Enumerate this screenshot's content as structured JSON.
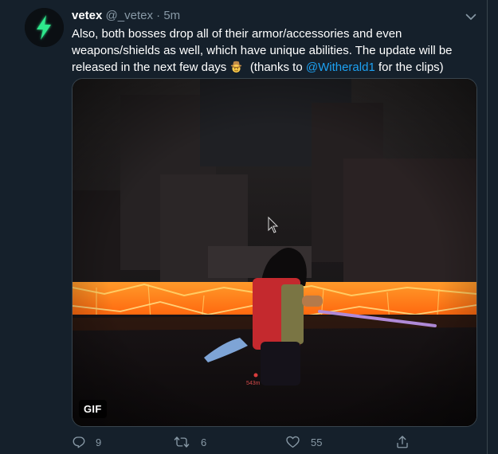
{
  "tweet": {
    "name": "vetex",
    "handle": "@_vetex",
    "separator": "·",
    "time": "5m",
    "text_line1": "Also, both bosses drop all of their armor/accessories and even",
    "text_line2": "weapons/shields as well, which have unique abilities. The update will be",
    "text_line3_before": "released in the next few days",
    "text_line3_paren_open": "(thanks to",
    "mention": "@Witherald1",
    "text_line3_after": "for the clips)"
  },
  "media": {
    "badge": "GIF",
    "overlay_text": "543m"
  },
  "actions": {
    "reply_count": "9",
    "retweet_count": "6",
    "like_count": "55"
  },
  "colors": {
    "background": "#15202b",
    "accent": "#1da1f2",
    "secondary_text": "#8899a6",
    "border": "#38444d",
    "avatar_bolt": "#2ee88c",
    "lava": "#ff7a1a"
  },
  "icons": {
    "avatar": "lightning-bolt-icon",
    "caret": "chevron-down-icon",
    "emoji": "cowboy-face-emoji-icon",
    "cursor": "mouse-cursor-icon",
    "reply": "reply-icon",
    "retweet": "retweet-icon",
    "like": "heart-icon",
    "share": "share-icon"
  }
}
